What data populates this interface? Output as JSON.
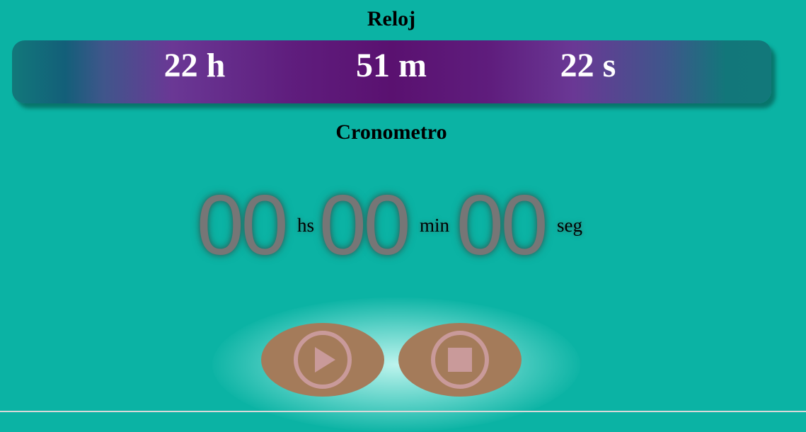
{
  "clock": {
    "title": "Reloj",
    "hours": "22 h",
    "minutes": "51 m",
    "seconds": "22 s"
  },
  "stopwatch": {
    "title": "Cronometro",
    "hours": "00",
    "hours_unit": "hs",
    "minutes": "00",
    "minutes_unit": "min",
    "seconds": "00",
    "seconds_unit": "seg"
  },
  "controls": {
    "play_icon": "play-icon",
    "stop_icon": "stop-icon"
  },
  "colors": {
    "background": "#0bb3a4",
    "bar_center": "#5a1170",
    "digits": "#767676",
    "button": "#a47b5a",
    "icon": "#c99a9a"
  }
}
